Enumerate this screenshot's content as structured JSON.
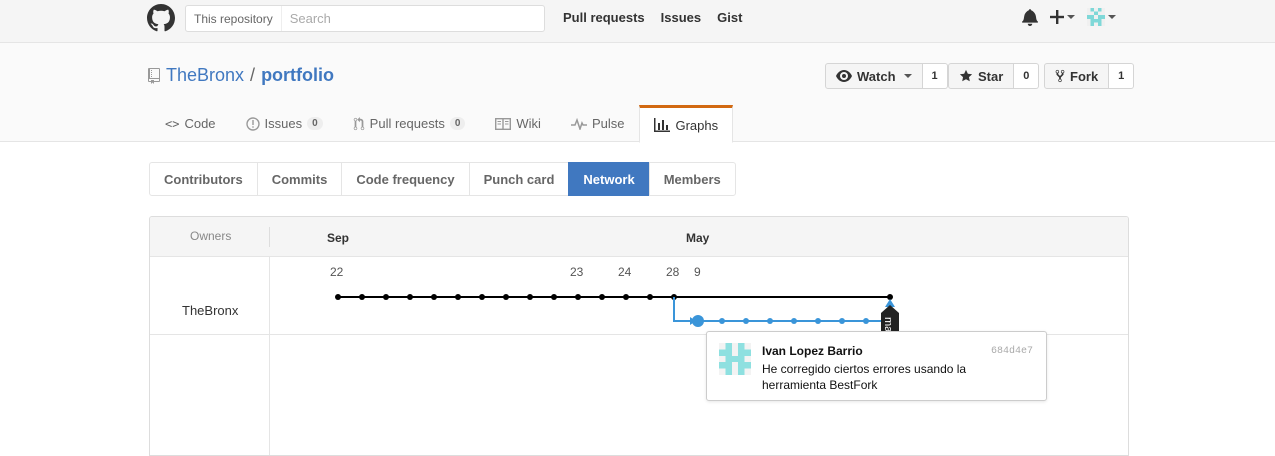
{
  "header": {
    "search_scope": "This repository",
    "search_placeholder": "Search",
    "nav": [
      "Pull requests",
      "Issues",
      "Gist"
    ]
  },
  "repo": {
    "owner": "TheBronx",
    "separator": "/",
    "name": "portfolio",
    "watch_label": "Watch",
    "watch_count": "1",
    "star_label": "Star",
    "star_count": "0",
    "fork_label": "Fork",
    "fork_count": "1"
  },
  "reponav": {
    "code": "Code",
    "issues": "Issues",
    "issues_count": "0",
    "pulls": "Pull requests",
    "pulls_count": "0",
    "wiki": "Wiki",
    "pulse": "Pulse",
    "graphs": "Graphs"
  },
  "subnav": {
    "contributors": "Contributors",
    "commits": "Commits",
    "code_frequency": "Code frequency",
    "punch_card": "Punch card",
    "network": "Network",
    "members": "Members"
  },
  "network": {
    "owners_label": "Owners",
    "months": [
      "Sep",
      "May"
    ],
    "days": [
      "22",
      "23",
      "24",
      "28",
      "9"
    ],
    "owner": "TheBronx",
    "branch_label": "ma",
    "main_color": "#000000",
    "fork_color": "#3a95d9"
  },
  "tooltip": {
    "author": "Ivan Lopez Barrio",
    "sha": "684d4e7",
    "message": "He corregido ciertos errores usando la herramienta BestFork"
  },
  "colors": {
    "link": "#4078c0",
    "active_tab": "#d26911"
  }
}
